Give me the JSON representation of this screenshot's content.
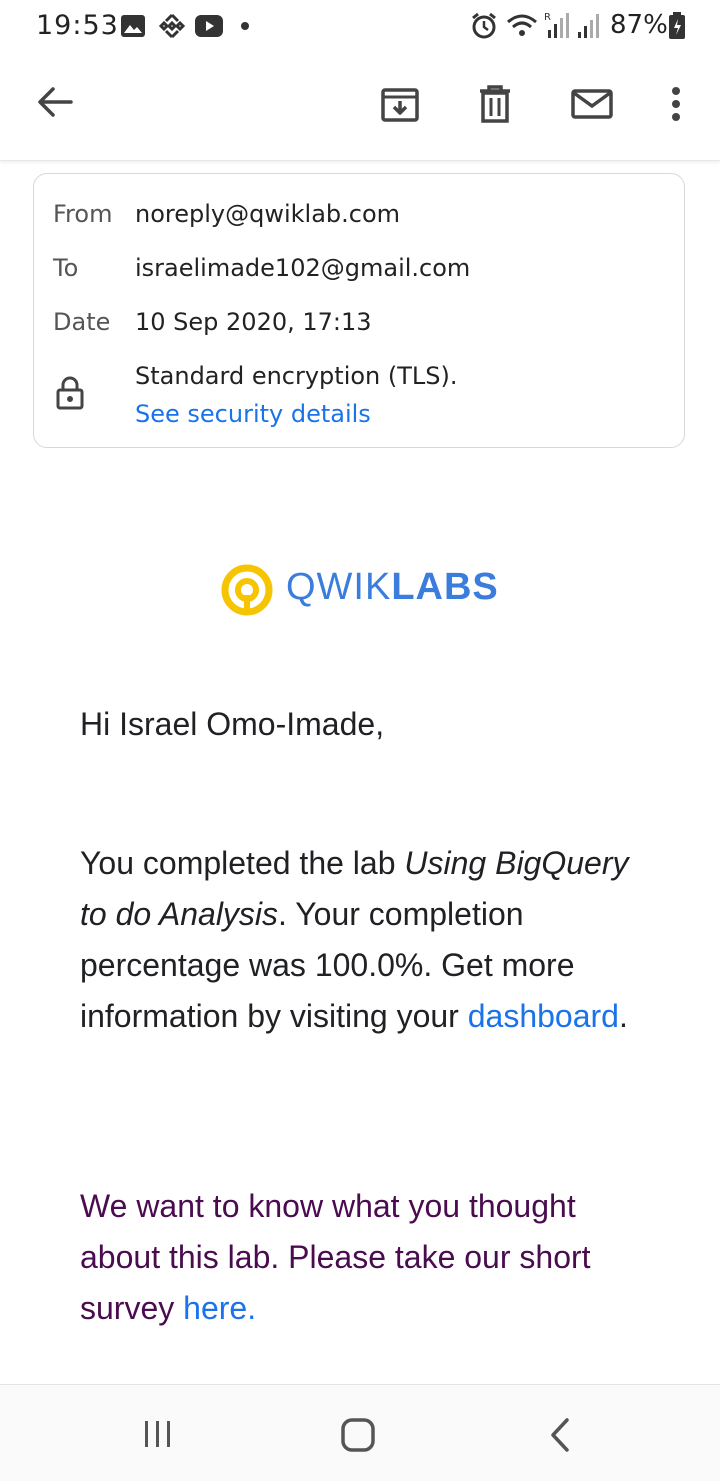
{
  "status_bar": {
    "time": "19:53",
    "battery": "87%",
    "icons": [
      "image-icon",
      "binance-icon",
      "youtube-icon",
      "dot-icon",
      "alarm-icon",
      "wifi-icon",
      "signal-icon",
      "signal-icon",
      "battery-icon"
    ]
  },
  "toolbar": {
    "icons": [
      "back-arrow-icon",
      "archive-icon",
      "delete-icon",
      "mail-icon",
      "more-vert-icon"
    ]
  },
  "details": {
    "from_label": "From",
    "from_value": "noreply@qwiklab.com",
    "to_label": "To",
    "to_value": "israelimade102@gmail.com",
    "date_label": "Date",
    "date_value": "10 Sep 2020, 17:13",
    "encryption_text": "Standard encryption (TLS).",
    "security_link": "See security details"
  },
  "logo": {
    "light": "QWIK",
    "bold": "LABS",
    "colors": {
      "ring": "#f6c400",
      "text": "#3b7ddd"
    }
  },
  "email": {
    "greeting": "Hi Israel Omo-Imade,",
    "p1_before": "You completed the lab ",
    "p1_lab": "Using BigQuery to do Analysis",
    "p1_after": ". Your completion percentage was 100.0%. Get more information by visiting your ",
    "p1_link": "dashboard",
    "p1_end": ".",
    "survey_text": "We want to know what you thought about this lab. Please take our short survey ",
    "survey_link": "here",
    "survey_end": "."
  },
  "navbar": {
    "icons": [
      "recents-icon",
      "home-icon",
      "back-icon"
    ]
  }
}
